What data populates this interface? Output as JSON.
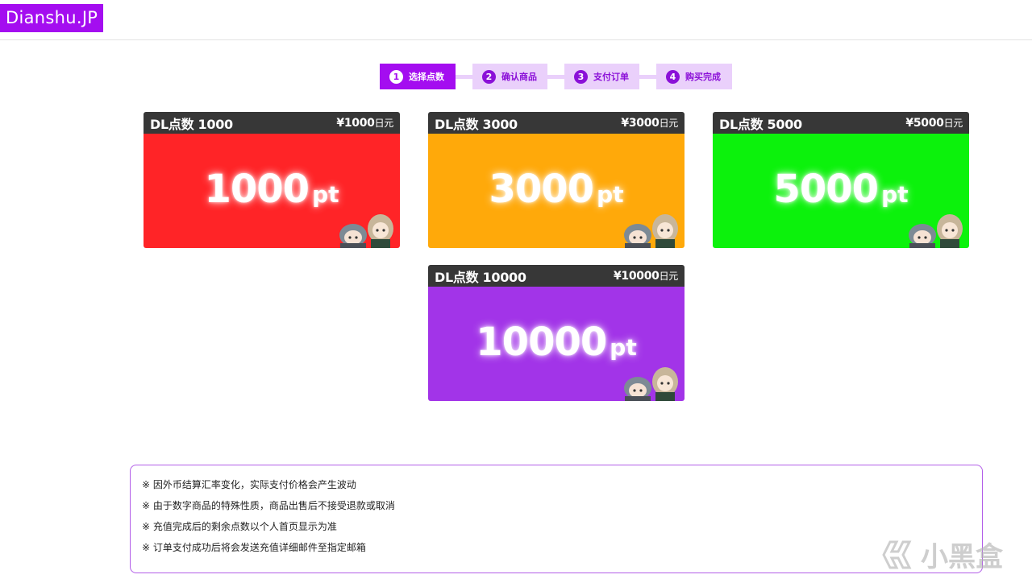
{
  "header": {
    "logo": "Dianshu.JP"
  },
  "steps": [
    {
      "num": "1",
      "label": "选择点数",
      "active": true
    },
    {
      "num": "2",
      "label": "确认商品",
      "active": false
    },
    {
      "num": "3",
      "label": "支付订单",
      "active": false
    },
    {
      "num": "4",
      "label": "购买完成",
      "active": false
    }
  ],
  "cards": [
    {
      "name": "DL点数 1000",
      "price": "¥1000",
      "currency": "日元",
      "amount": "1000",
      "unit": "pt",
      "color": "#ff2427"
    },
    {
      "name": "DL点数 3000",
      "price": "¥3000",
      "currency": "日元",
      "amount": "3000",
      "unit": "pt",
      "color": "#ffa90a"
    },
    {
      "name": "DL点数 5000",
      "price": "¥5000",
      "currency": "日元",
      "amount": "5000",
      "unit": "pt",
      "color": "#0cf20c"
    },
    {
      "name": "DL点数 10000",
      "price": "¥10000",
      "currency": "日元",
      "amount": "10000",
      "unit": "pt",
      "color": "#a234e8"
    }
  ],
  "notices": [
    "※ 因外币结算汇率变化，实际支付价格会产生波动",
    "※ 由于数字商品的特殊性质，商品出售后不接受退款或取消",
    "※ 充值完成后的剩余点数以个人首页显示为准",
    "※ 订单支付成功后将会发送充值详细邮件至指定邮箱"
  ],
  "watermark": {
    "text": "小黑盒",
    "icon": "heybox-logo-icon"
  },
  "accent_color": "#a40df0"
}
